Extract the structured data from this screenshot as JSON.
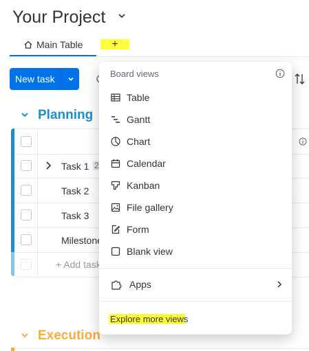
{
  "project": {
    "title": "Your Project"
  },
  "tabs": {
    "main_label": "Main Table",
    "add_label": "+"
  },
  "toolbar": {
    "new_task_label": "New task"
  },
  "groups": {
    "planning": {
      "title": "Planning",
      "color": "#1a8fd0",
      "rows": [
        {
          "name": "Task 1",
          "badge": "2"
        },
        {
          "name": "Task 2"
        },
        {
          "name": "Task 3"
        },
        {
          "name": "Milestone"
        }
      ],
      "add_label": "+ Add task"
    },
    "execution": {
      "title": "Execution",
      "color": "#fdab3d"
    }
  },
  "menu": {
    "header": "Board views",
    "items": [
      {
        "label": "Table",
        "icon": "table-icon"
      },
      {
        "label": "Gantt",
        "icon": "gantt-icon"
      },
      {
        "label": "Chart",
        "icon": "chart-icon"
      },
      {
        "label": "Calendar",
        "icon": "calendar-icon"
      },
      {
        "label": "Kanban",
        "icon": "kanban-icon"
      },
      {
        "label": "File gallery",
        "icon": "file-gallery-icon"
      },
      {
        "label": "Form",
        "icon": "form-icon"
      },
      {
        "label": "Blank view",
        "icon": "blank-view-icon"
      }
    ],
    "apps_label": "Apps",
    "explore_label": "Explore more views"
  },
  "colors": {
    "accent": "#0073ea",
    "highlight": "#ffff3a"
  }
}
